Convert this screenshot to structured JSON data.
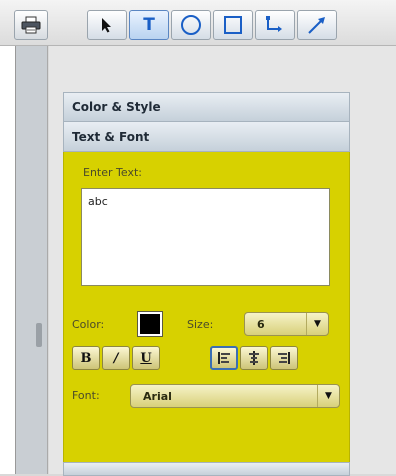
{
  "toolbar": {
    "print_icon": "printer-icon",
    "tools": [
      {
        "name": "tool-select",
        "icon": "arrow-cursor-icon",
        "label": ""
      },
      {
        "name": "tool-text",
        "icon": "text-icon",
        "label": "T"
      },
      {
        "name": "tool-ellipse",
        "icon": "circle-icon",
        "label": ""
      },
      {
        "name": "tool-rectangle",
        "icon": "square-icon",
        "label": ""
      },
      {
        "name": "tool-connector",
        "icon": "connector-icon",
        "label": ""
      },
      {
        "name": "tool-line",
        "icon": "line-arrow-icon",
        "label": ""
      }
    ]
  },
  "panel": {
    "sections": {
      "color_style": "Color & Style",
      "text_font": "Text & Font"
    },
    "text_font": {
      "enter_text_label": "Enter Text:",
      "text_value": "abc",
      "color_label": "Color:",
      "color_value": "#000000",
      "size_label": "Size:",
      "size_value": "6",
      "bold_label": "B",
      "italic_label": "/",
      "underline_label": "U",
      "alignments": [
        "align-left",
        "align-center",
        "align-right"
      ],
      "selected_alignment": "align-left",
      "font_label": "Font:",
      "font_value": "Arial"
    }
  },
  "colors": {
    "panel_bg": "#d7d100",
    "accent": "#1a5fc6"
  }
}
